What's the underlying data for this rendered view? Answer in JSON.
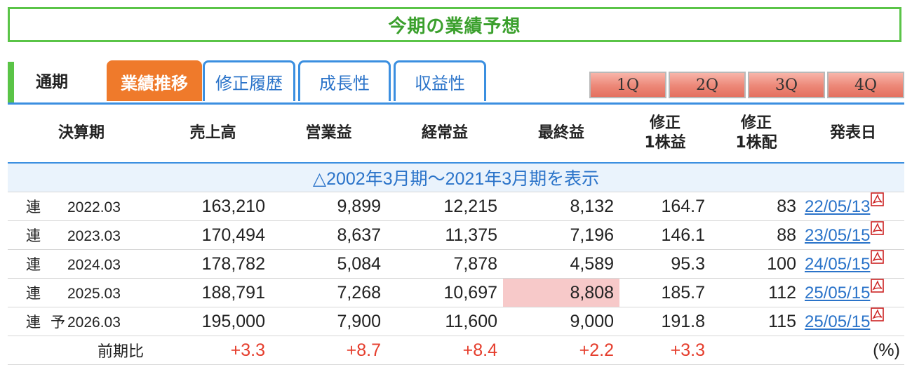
{
  "title": "今期の業績予想",
  "tabs": {
    "static": "通期",
    "items": [
      "業績推移",
      "修正履歴",
      "成長性",
      "収益性"
    ],
    "active_index": 0
  },
  "quarters": [
    "1Q",
    "2Q",
    "3Q",
    "4Q"
  ],
  "table": {
    "headers": [
      "決算期",
      "売上高",
      "営業益",
      "経常益",
      "最終益",
      "修正\n1株益",
      "修正\n1株配",
      "発表日"
    ],
    "expand_link": "△2002年3月期～2021年3月期を表示",
    "rows": [
      {
        "type": "連",
        "forecast": "",
        "period": "2022.03",
        "sales": "163,210",
        "operating": "9,899",
        "ordinary": "12,215",
        "net": "8,132",
        "eps": "164.7",
        "dps": "83",
        "date": "22/05/13"
      },
      {
        "type": "連",
        "forecast": "",
        "period": "2023.03",
        "sales": "170,494",
        "operating": "8,637",
        "ordinary": "11,375",
        "net": "7,196",
        "eps": "146.1",
        "dps": "88",
        "date": "23/05/15"
      },
      {
        "type": "連",
        "forecast": "",
        "period": "2024.03",
        "sales": "178,782",
        "operating": "5,084",
        "ordinary": "7,878",
        "net": "4,589",
        "eps": "95.3",
        "dps": "100",
        "date": "24/05/15"
      },
      {
        "type": "連",
        "forecast": "",
        "period": "2025.03",
        "sales": "188,791",
        "operating": "7,268",
        "ordinary": "10,697",
        "net": "8,808",
        "eps": "185.7",
        "dps": "112",
        "date": "25/05/15"
      },
      {
        "type": "連",
        "forecast": "予",
        "period": "2026.03",
        "sales": "195,000",
        "operating": "7,900",
        "ordinary": "11,600",
        "net": "9,000",
        "eps": "191.8",
        "dps": "115",
        "date": "25/05/15"
      }
    ],
    "ratio": {
      "label": "前期比",
      "sales": "+3.3",
      "operating": "+8.7",
      "ordinary": "+8.4",
      "net": "+2.2",
      "eps": "+3.3",
      "unit": "(%)"
    }
  },
  "colors": {
    "title_green": "#3ba02d",
    "border_green": "#5ac447",
    "tab_blue": "#3b8fe0",
    "active_orange": "#ef7a2b",
    "positive_red": "#e53d2c",
    "highlight_pink": "#f7c9c9",
    "link_blue": "#2a73c9"
  },
  "icons": {
    "date_suffix": "pdf-icon"
  }
}
